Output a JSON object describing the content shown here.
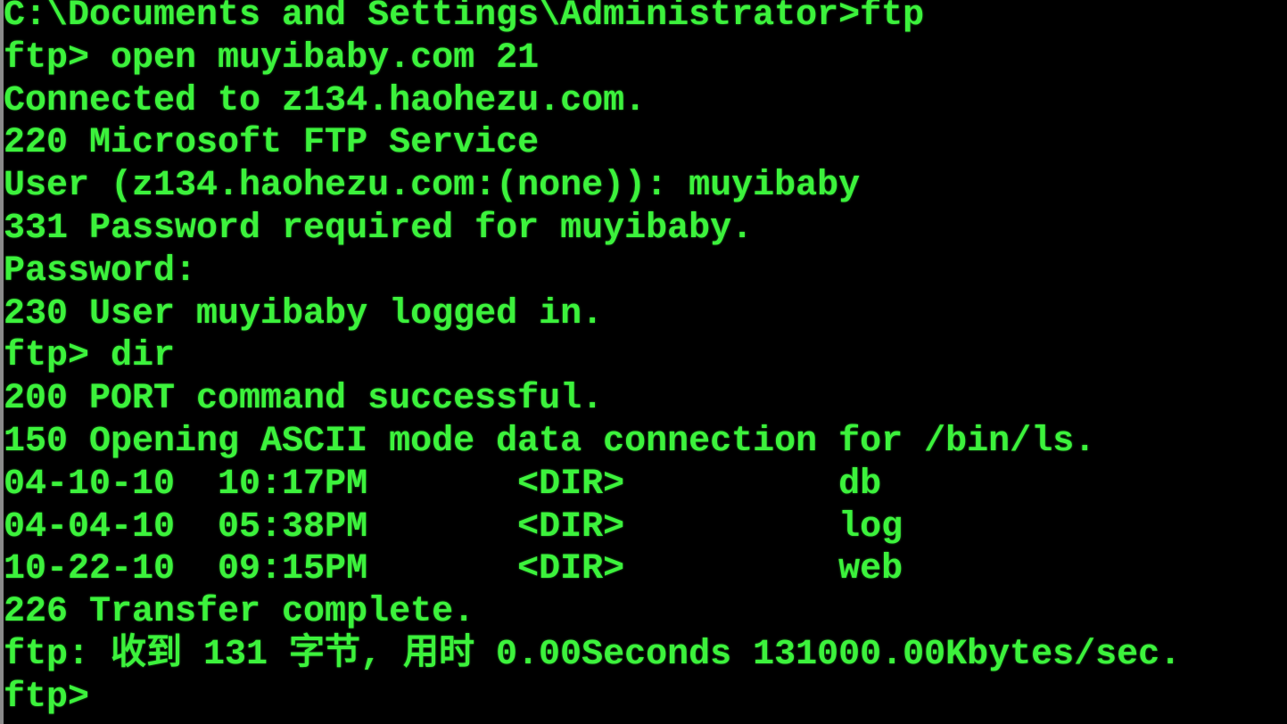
{
  "terminal": {
    "text_color": "#3cf23c",
    "background": "#000000",
    "lines": [
      "C:\\Documents and Settings\\Administrator>ftp",
      "ftp> open muyibaby.com 21",
      "Connected to z134.haohezu.com.",
      "220 Microsoft FTP Service",
      "User (z134.haohezu.com:(none)): muyibaby",
      "331 Password required for muyibaby.",
      "Password:",
      "230 User muyibaby logged in.",
      "ftp> dir",
      "200 PORT command successful.",
      "150 Opening ASCII mode data connection for /bin/ls.",
      "04-10-10  10:17PM       <DIR>          db",
      "04-04-10  05:38PM       <DIR>          log",
      "10-22-10  09:15PM       <DIR>          web",
      "226 Transfer complete.",
      "ftp: 收到 131 字节, 用时 0.00Seconds 131000.00Kbytes/sec.",
      "ftp>"
    ]
  }
}
